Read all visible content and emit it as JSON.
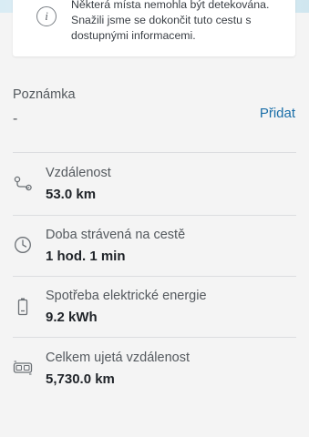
{
  "info": {
    "line1": "Některá místa nemohla být detekována.",
    "line2": "Snažili jsme se dokončit tuto cestu s",
    "line3": "dostupnými informacemi."
  },
  "note": {
    "label": "Poznámka",
    "value": "-",
    "add_label": "Přidat"
  },
  "stats": [
    {
      "icon": "route-icon",
      "label": "Vzdálenost",
      "value": "53.0 km"
    },
    {
      "icon": "clock-icon",
      "label": "Doba strávená na cestě",
      "value": "1 hod. 1 min"
    },
    {
      "icon": "battery-icon",
      "label": "Spotřeba elektrické energie",
      "value": "9.2 kWh"
    },
    {
      "icon": "odometer-icon",
      "label": "Celkem ujetá vzdálenost",
      "value": "5,730.0 km"
    }
  ],
  "colors": {
    "background": "#f4f4f4",
    "accent": "#1a6ea8",
    "text_primary": "#1f2328",
    "text_secondary": "#54595e"
  }
}
